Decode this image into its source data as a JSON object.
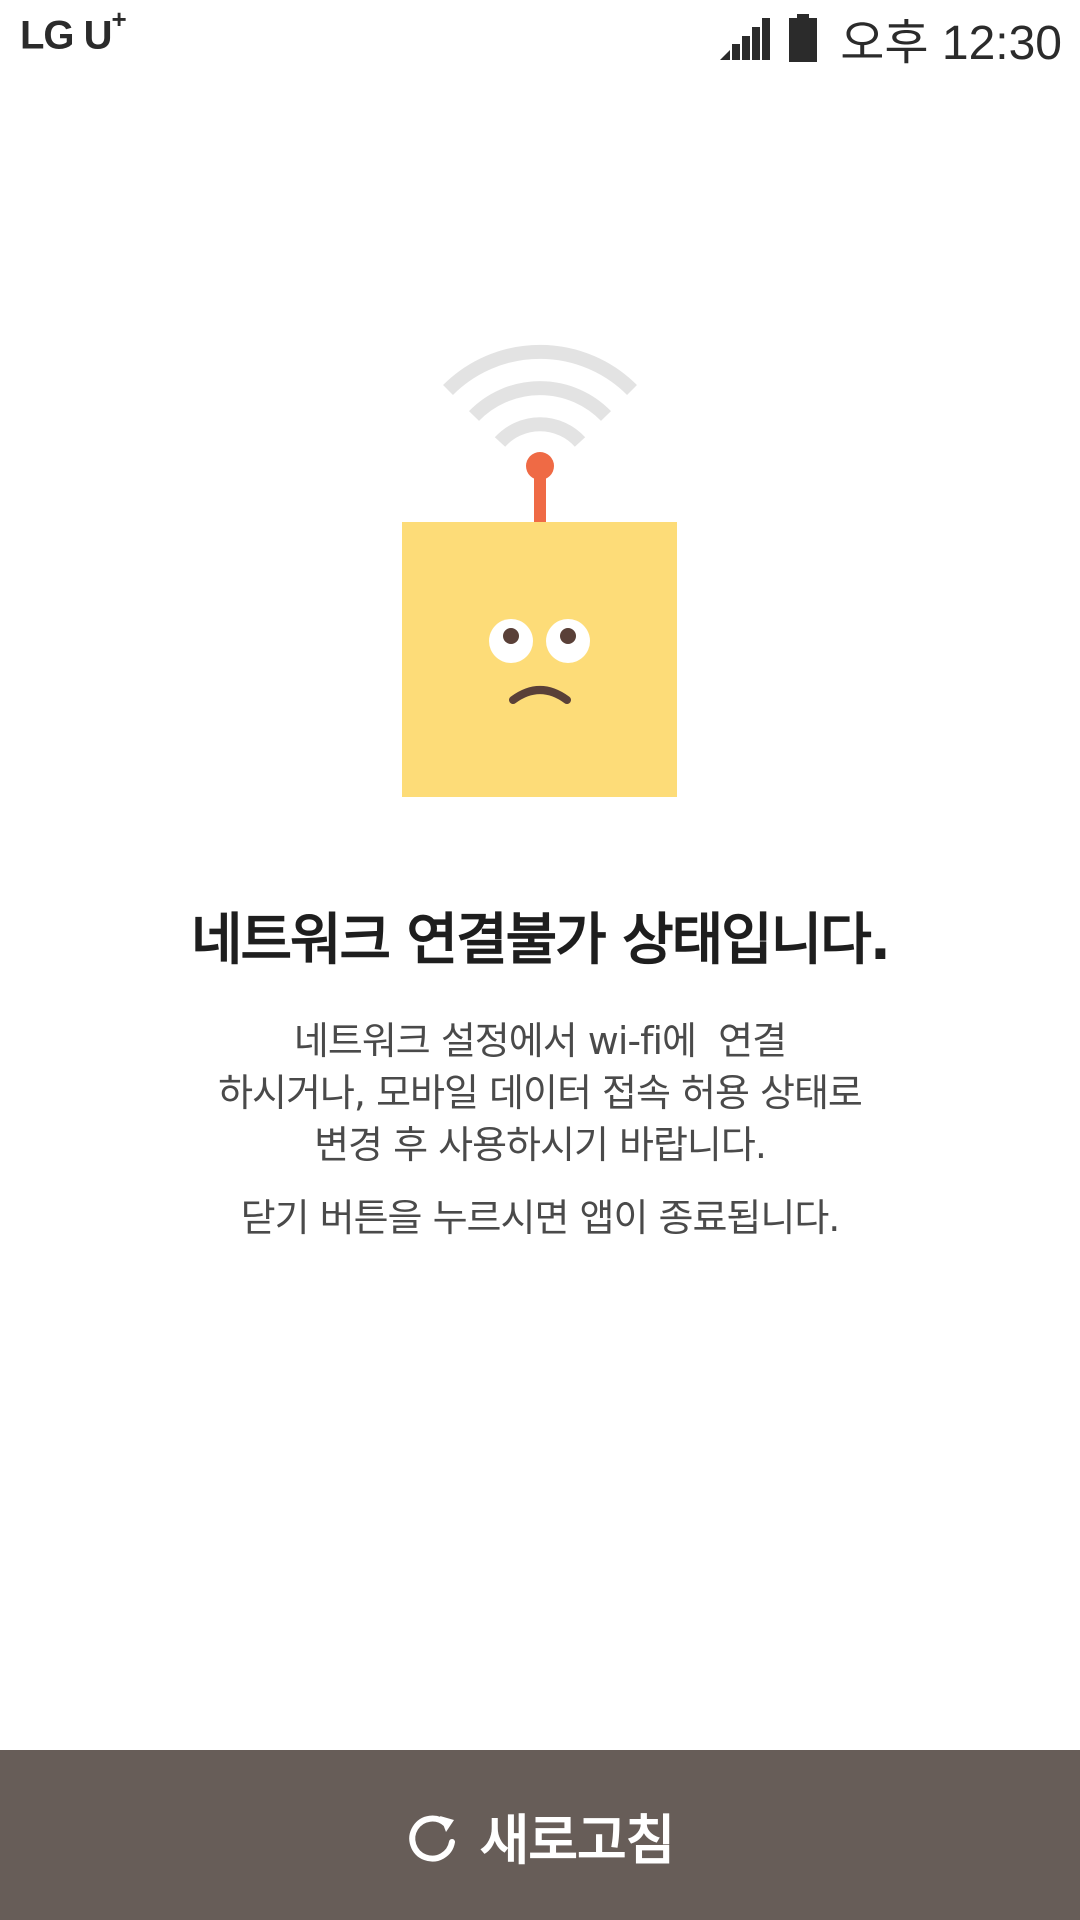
{
  "status_bar": {
    "carrier": "LG U",
    "carrier_mark": "+",
    "time": "오후 12:30",
    "signal_icon": "cellular-signal-icon",
    "battery_icon": "battery-icon"
  },
  "illustration": {
    "icon": "sad-router-icon",
    "colors": {
      "wifi_arcs": "#e3e3e3",
      "antenna": "#ef6a45",
      "box": "#fddc78",
      "face": "#5a4038"
    }
  },
  "message": {
    "title": "네트워크 연결불가 상태입니다.",
    "description_lines": [
      "네트워크 설정에서 wi-fi에  연결",
      "하시거나, 모바일 데이터 접속 허용 상태로",
      "변경 후 사용하시기 바랍니다."
    ],
    "close_notice": "닫기 버튼을 누르시면 앱이 종료됩니다."
  },
  "refresh_button": {
    "label": "새로고침",
    "icon": "refresh-icon",
    "background": "#675d58"
  }
}
